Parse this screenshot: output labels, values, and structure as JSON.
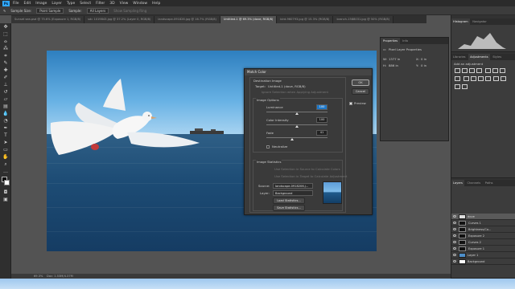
{
  "app": {
    "logo_text": "Ps"
  },
  "menu": [
    "File",
    "Edit",
    "Image",
    "Layer",
    "Type",
    "Select",
    "Filter",
    "3D",
    "View",
    "Window",
    "Help"
  ],
  "options_bar": {
    "sample_size_label": "Sample Size:",
    "sample_size_value": "Point Sample",
    "sample_label": "Sample:",
    "sample_value": "All Layers",
    "show_ring": "Show Sampling Ring"
  },
  "document_tabs": [
    "Sunset sea.psd @ 75.6% (Exposure 1, RGB/8)",
    "sdc 1019843.jpg @ 37.2% (Layer 0, RGB/8)",
    "landscape-091826.jpg @ 16.7% (RGB/8)",
    "Untitled-1 @ 69.3% (dove, RGB/8)",
    "bird-960793.jpg @ 15.3% (RGB/8)",
    "branch-1588031.jpg @ 50% (RGB/8)"
  ],
  "active_tab_index": 3,
  "tools": [
    "move",
    "marquee",
    "lasso",
    "quick-select",
    "crop",
    "eyedropper",
    "healing",
    "brush",
    "stamp",
    "history",
    "eraser",
    "gradient",
    "blur",
    "dodge",
    "pen",
    "type",
    "path-select",
    "shape",
    "hand",
    "zoom"
  ],
  "match_color": {
    "title": "Match Color",
    "destination_label": "Destination Image",
    "target_label": "Target:",
    "target_value": "Untitled-1 (dove, RGB/8)",
    "ignore_selection": "Ignore Selection when Applying Adjustment",
    "image_options_label": "Image Options",
    "luminance_label": "Luminance",
    "luminance_value": "100",
    "color_intensity_label": "Color Intensity",
    "color_intensity_value": "100",
    "fade_label": "Fade",
    "fade_value": "41",
    "neutralize_label": "Neutralize",
    "image_statistics_label": "Image Statistics",
    "use_sel_source": "Use Selection in Source to Calculate Colors",
    "use_sel_target": "Use Selection in Target to Calculate Adjustment",
    "source_label": "Source:",
    "source_value": "landscape-0918206.j...",
    "layer_label": "Layer:",
    "layer_value": "Background",
    "load_stats": "Load Statistics...",
    "save_stats": "Save Statistics...",
    "ok_label": "OK",
    "cancel_label": "Cancel",
    "preview_label": "Preview",
    "preview_checked": true
  },
  "properties": {
    "tabs": [
      "Properties",
      "Info"
    ],
    "header": "Pixel Layer Properties",
    "w_label": "W:",
    "w_value": "1377 in",
    "h_label": "H:",
    "h_value": "886 in",
    "x_label": "X:",
    "x_value": "0 in",
    "y_label": "Y:",
    "y_value": "0 in"
  },
  "right_panels": {
    "top_tabs": [
      "Histogram",
      "Navigator"
    ],
    "mid_tabs": [
      "Libraries",
      "Adjustments",
      "Styles"
    ],
    "add_adjustment": "Add an adjustment",
    "layers_tabs": [
      "Layers",
      "Channels",
      "Paths"
    ]
  },
  "layers": [
    {
      "name": "dove",
      "selected": true
    },
    {
      "name": "Curves 1",
      "selected": false
    },
    {
      "name": "Brightness/Co...",
      "selected": false
    },
    {
      "name": "Exposure 2",
      "selected": false
    },
    {
      "name": "Curves 2",
      "selected": false
    },
    {
      "name": "Exposure 1",
      "selected": false
    },
    {
      "name": "Layer 1",
      "selected": false
    },
    {
      "name": "Background",
      "selected": false
    }
  ],
  "status": {
    "zoom": "69.3%",
    "doc": "Doc: 1.53M/4.37M"
  }
}
